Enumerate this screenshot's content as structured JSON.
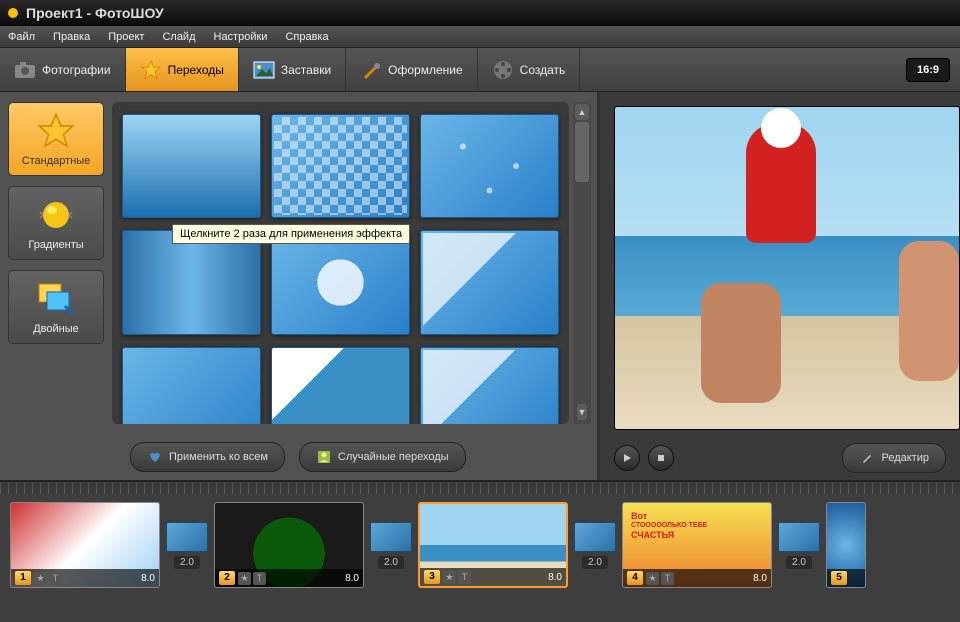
{
  "titlebar": {
    "title": "Проект1 - ФотоШОУ"
  },
  "menu": {
    "file": "Файл",
    "edit": "Правка",
    "project": "Проект",
    "slide": "Слайд",
    "settings": "Настройки",
    "help": "Справка"
  },
  "tabs": {
    "photos": "Фотографии",
    "transitions": "Переходы",
    "intros": "Заставки",
    "design": "Оформление",
    "create": "Создать"
  },
  "aspect_ratio": "16:9",
  "categories": {
    "standard": "Стандартные",
    "gradients": "Градиенты",
    "double": "Двойные"
  },
  "tooltip": "Щелкните 2 раза для применения эффекта",
  "buttons": {
    "apply_all": "Применить ко всем",
    "random": "Случайные переходы",
    "edit_slide": "Редактир"
  },
  "timeline": {
    "slides": [
      {
        "num": "1",
        "dur": "8.0"
      },
      {
        "num": "2",
        "dur": "8.0"
      },
      {
        "num": "3",
        "dur": "8.0"
      },
      {
        "num": "4",
        "dur": "8.0"
      },
      {
        "num": "5",
        "dur": ""
      }
    ],
    "trans_dur": "2.0"
  },
  "slide4_text": {
    "l1": "Вот",
    "l2": "СТОООООЛЬКО ТЕБЕ",
    "l3": "СЧАСТЬЯ"
  }
}
